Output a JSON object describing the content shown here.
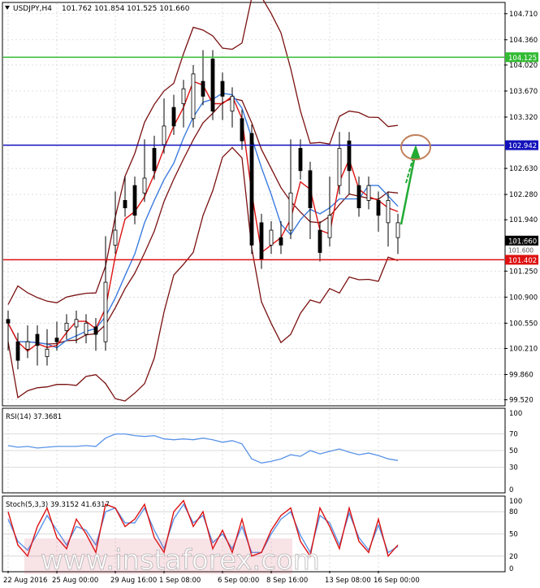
{
  "header": {
    "symbol": "USDJPY,H4",
    "ohlc": "101.762 101.854 101.525 101.660"
  },
  "chart_data": [
    {
      "type": "candlestick",
      "panel": "price",
      "ylim": [
        99.45,
        104.85
      ],
      "price_ticks": [
        "104.710",
        "104.360",
        "104.020",
        "103.670",
        "103.320",
        "102.630",
        "102.280",
        "101.940",
        "101.250",
        "100.900",
        "100.550",
        "100.210",
        "99.860",
        "99.520"
      ],
      "x_labels": [
        "22 Aug 2016",
        "25 Aug 00:00",
        "29 Aug 16:00",
        "1 Sep 08:00",
        "6 Sep 00:00",
        "8 Sep 16:00",
        "13 Sep 08:00",
        "16 Sep 00:00"
      ],
      "candles": [
        [
          100.6,
          100.55,
          100.3
        ],
        [
          100.3,
          100.05,
          100.2
        ],
        [
          100.2,
          100.3,
          100.4
        ],
        [
          100.4,
          100.25,
          100.1
        ],
        [
          100.1,
          100.2,
          100.35
        ],
        [
          100.35,
          100.3,
          100.45
        ],
        [
          100.45,
          100.55,
          100.5
        ],
        [
          100.5,
          100.6,
          100.4
        ],
        [
          100.4,
          100.55,
          100.5
        ],
        [
          100.5,
          100.4,
          100.3
        ],
        [
          100.3,
          101.1,
          101.6
        ],
        [
          101.6,
          101.8,
          102.2
        ],
        [
          102.2,
          102.1,
          102.4
        ],
        [
          102.4,
          102.0,
          102.3
        ],
        [
          102.3,
          102.5,
          102.9
        ],
        [
          102.9,
          102.6,
          102.95
        ],
        [
          102.95,
          103.2,
          103.45
        ],
        [
          103.45,
          103.2,
          103.5
        ],
        [
          103.5,
          103.7,
          103.3
        ],
        [
          103.3,
          103.9,
          103.8
        ],
        [
          103.8,
          103.6,
          104.1
        ],
        [
          104.1,
          103.4,
          103.8
        ],
        [
          103.8,
          103.6,
          103.4
        ],
        [
          103.4,
          103.6,
          103.3
        ],
        [
          103.3,
          103.0,
          103.1
        ],
        [
          103.1,
          101.6,
          101.9
        ],
        [
          101.9,
          101.4,
          101.6
        ],
        [
          101.6,
          101.8,
          101.7
        ],
        [
          101.7,
          101.6,
          101.8
        ],
        [
          101.8,
          102.3,
          102.9
        ],
        [
          102.9,
          102.6,
          102.6
        ],
        [
          102.6,
          102.1,
          101.8
        ],
        [
          101.8,
          101.5,
          101.7
        ],
        [
          101.7,
          102.0,
          102.4
        ],
        [
          102.4,
          102.9,
          103.0
        ],
        [
          103.0,
          102.6,
          102.4
        ],
        [
          102.4,
          102.1,
          102.2
        ],
        [
          102.2,
          102.4,
          102.2
        ],
        [
          102.2,
          102.0,
          101.9
        ],
        [
          101.9,
          102.2,
          101.7
        ],
        [
          101.7,
          101.9,
          101.6
        ]
      ],
      "levels": [
        {
          "value": 104.125,
          "label": "104.125",
          "color": "#33bb33"
        },
        {
          "value": 102.942,
          "label": "102.942",
          "color": "#1111bb"
        },
        {
          "value": 101.66,
          "label": "101.660",
          "color": "#000000"
        },
        {
          "value": 101.402,
          "label": "101.402",
          "color": "#dd1111"
        }
      ],
      "hidden_tick_labels": [
        "101.5?",
        "101.600"
      ]
    },
    {
      "type": "line",
      "panel": "rsi",
      "label": "RSI(14) 37.3681",
      "ylim": [
        0,
        100
      ],
      "ticks": [
        "100",
        "70",
        "50",
        "30",
        "0"
      ],
      "values": [
        56,
        54,
        55,
        53,
        54,
        55,
        55,
        55,
        56,
        55,
        65,
        70,
        70,
        68,
        67,
        68,
        64,
        63,
        64,
        63,
        65,
        63,
        60,
        62,
        58,
        40,
        35,
        37,
        40,
        45,
        43,
        50,
        46,
        49,
        52,
        48,
        45,
        47,
        44,
        40,
        38
      ]
    },
    {
      "type": "line",
      "panel": "stochastic",
      "label": "Stoch(5,3,3) 39.3152 41.6317",
      "ylim": [
        0,
        100
      ],
      "ticks": [
        "100",
        "80",
        "50",
        "20",
        "0"
      ],
      "main": [
        80,
        35,
        20,
        60,
        85,
        45,
        30,
        70,
        50,
        25,
        90,
        85,
        60,
        70,
        90,
        45,
        25,
        80,
        95,
        60,
        80,
        30,
        55,
        25,
        70,
        20,
        25,
        55,
        75,
        85,
        40,
        20,
        85,
        60,
        30,
        85,
        40,
        25,
        70,
        20,
        35
      ],
      "signal": [
        70,
        40,
        28,
        50,
        75,
        55,
        35,
        60,
        55,
        35,
        80,
        85,
        65,
        65,
        85,
        55,
        30,
        70,
        90,
        65,
        75,
        38,
        50,
        30,
        60,
        25,
        25,
        50,
        70,
        80,
        48,
        25,
        75,
        65,
        35,
        78,
        45,
        28,
        62,
        25,
        33
      ]
    }
  ],
  "watermark": "www.instaforex.com",
  "colors": {
    "grid": "#d0d0d0",
    "bollinger": "#7a1010",
    "ma_fast": "#dd1111",
    "ma_slow": "#3a7be0",
    "rsi_line": "#5a93e8",
    "stoch_main": "#dd1111",
    "stoch_signal": "#5a93e8",
    "target_circle": "#c0805a",
    "forecast_arrow": "#22aa33"
  }
}
